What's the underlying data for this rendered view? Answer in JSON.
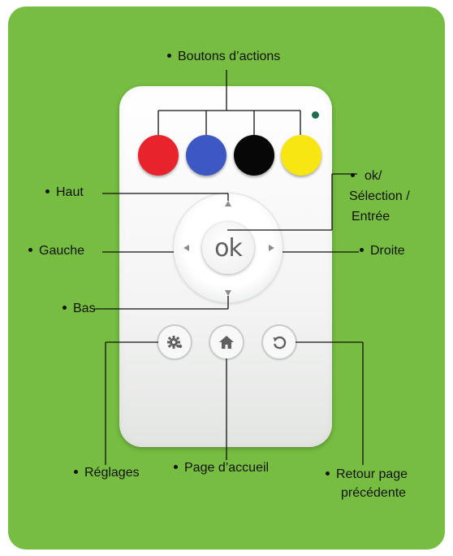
{
  "colors": {
    "background": "#76bd41",
    "red_button": "#e8232b",
    "blue_button": "#3d58c2",
    "black_button": "#070707",
    "yellow_button": "#f8e612"
  },
  "remote": {
    "ok_label": "ok",
    "settings_icon": "gear-icon",
    "home_icon": "home-icon",
    "back_icon": "return-arrow-icon"
  },
  "labels": {
    "action_buttons": "Boutons d’actions",
    "up": "Haut",
    "ok_line1": "ok/",
    "ok_line2": "Sélection /",
    "ok_line3": "Entrée",
    "left": "Gauche",
    "right": "Droite",
    "down": "Bas",
    "settings": "Réglages",
    "home": "Page d’accueil",
    "back_line1": "Retour page",
    "back_line2": "précédente"
  }
}
